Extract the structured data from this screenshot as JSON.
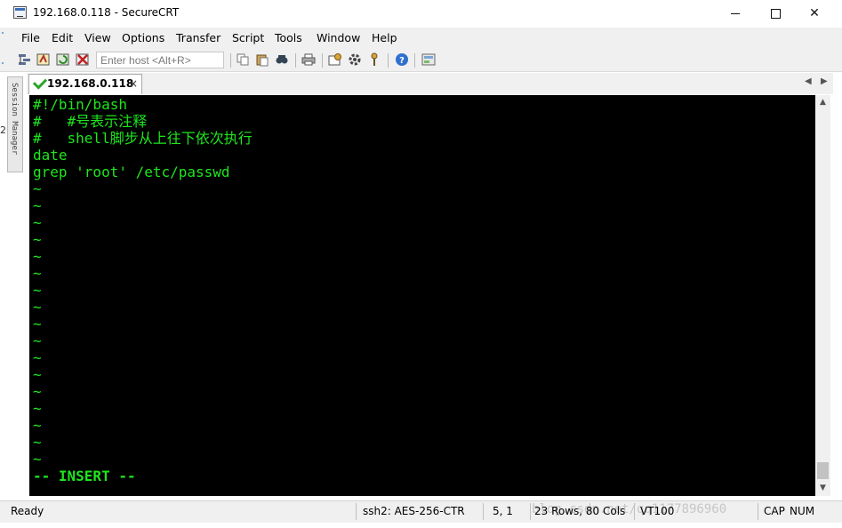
{
  "window": {
    "title": "192.168.0.118 - SecureCRT",
    "minimize": "—",
    "maximize": "☐",
    "close": "✕"
  },
  "menu": {
    "items": [
      "File",
      "Edit",
      "View",
      "Options",
      "Transfer",
      "Script",
      "Tools",
      "Window",
      "Help"
    ]
  },
  "toolbar": {
    "host_placeholder": "Enter host <Alt+R>",
    "icons": [
      "connect-icon",
      "quick-connect-icon",
      "reconnect-icon",
      "disconnect-icon",
      "copy-icon",
      "paste-icon",
      "find-icon",
      "print-icon",
      "session-options-icon",
      "global-options-icon",
      "keymap-icon",
      "help-icon",
      "sftp-icon"
    ]
  },
  "side": {
    "session_manager": "Session Manager",
    "edge_marker": "2"
  },
  "tab": {
    "title": "192.168.0.118",
    "close": "×",
    "prev": "◀",
    "next": "▶"
  },
  "terminal": {
    "text_color": "#1ee61e",
    "background": "#000000",
    "lines": [
      "#!/bin/bash",
      "#   #号表示注释",
      "#   shell脚步从上往下依次执行",
      "date",
      "grep 'root' /etc/passwd",
      "~",
      "~",
      "~",
      "~",
      "~",
      "~",
      "~",
      "~",
      "~",
      "~",
      "~",
      "~",
      "~",
      "~",
      "~",
      "~",
      "~",
      "-- INSERT --"
    ]
  },
  "status": {
    "ready": "Ready",
    "cipher": "ssh2: AES-256-CTR",
    "position": "5,   1",
    "size": "23 Rows, 80 Cols",
    "terminal_type": "VT100",
    "cap": "CAP",
    "num": "NUM",
    "watermark": "blog.csdn.net/qq1177896960"
  }
}
